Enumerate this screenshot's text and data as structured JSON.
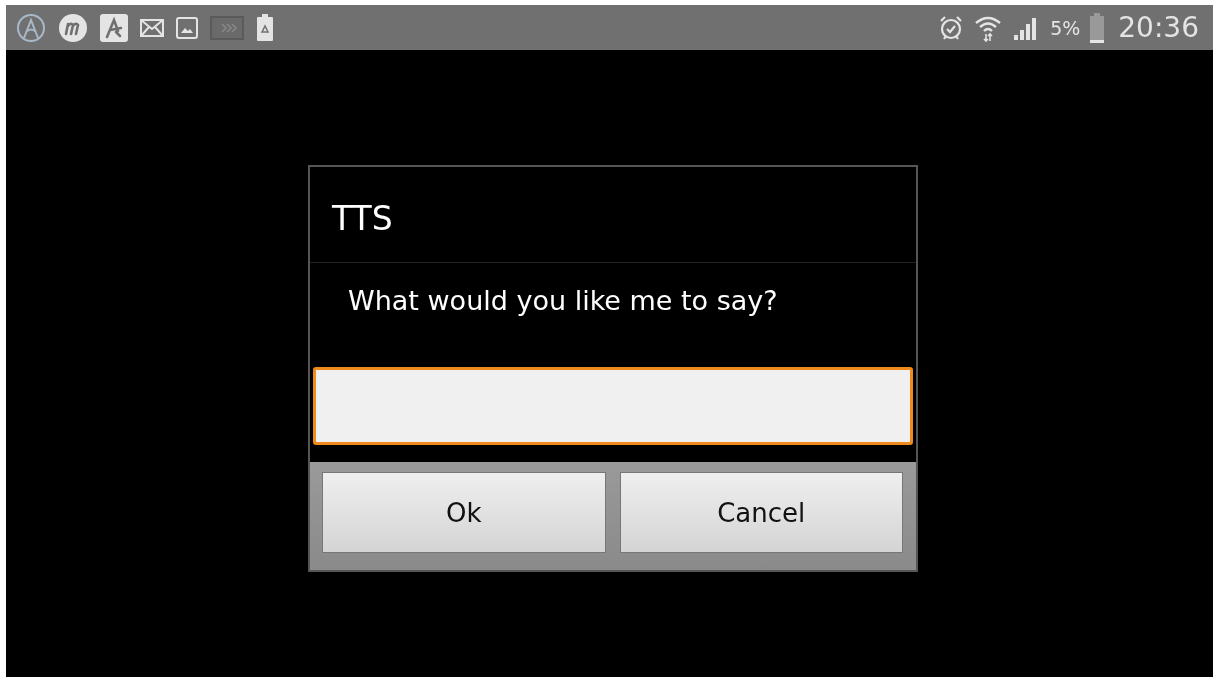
{
  "status_bar": {
    "battery_percent": "5%",
    "time": "20:36"
  },
  "dialog": {
    "title": "TTS",
    "message": "What would you like me to say?",
    "input": {
      "focused": true
    },
    "buttons": [
      {
        "label": "Ok"
      },
      {
        "label": "Cancel"
      }
    ]
  }
}
